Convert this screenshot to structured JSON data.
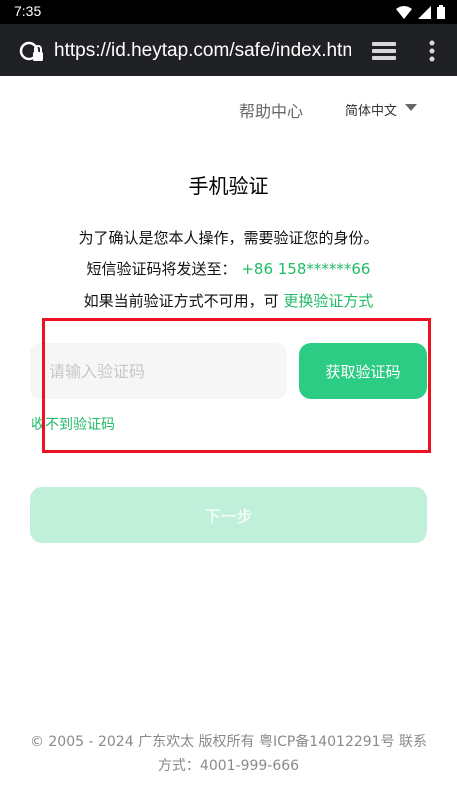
{
  "status_bar": {
    "time": "7:35",
    "icons": [
      "wifi-icon",
      "cell-signal-icon",
      "battery-icon"
    ]
  },
  "browser": {
    "url": "https://id.heytap.com/safe/index.html",
    "icons": [
      "site-info-icon",
      "tabs-icon",
      "more-menu-icon"
    ]
  },
  "header": {
    "help_label": "帮助中心",
    "language_label": "简体中文"
  },
  "main": {
    "title": "手机验证",
    "line1": "为了确认是您本人操作，需要验证您的身份。",
    "line2_prefix": "短信验证码将发送至：",
    "phone": "+86 158******66",
    "line3_prefix": "如果当前验证方式不可用，可",
    "change_method_label": "更换验证方式",
    "code_placeholder": "请输入验证码",
    "code_value": "",
    "get_code_label": "获取验证码",
    "no_code_label": "收不到验证码",
    "next_label": "下一步"
  },
  "footer": {
    "text": "© 2005 - 2024 广东欢太 版权所有 粤ICP备14012291号 联系方式：4001-999-666"
  },
  "colors": {
    "accent": "#2ccc84",
    "accent_disabled": "#c0f0da",
    "link": "#22bb66",
    "annotation_box": "#ee1122"
  }
}
